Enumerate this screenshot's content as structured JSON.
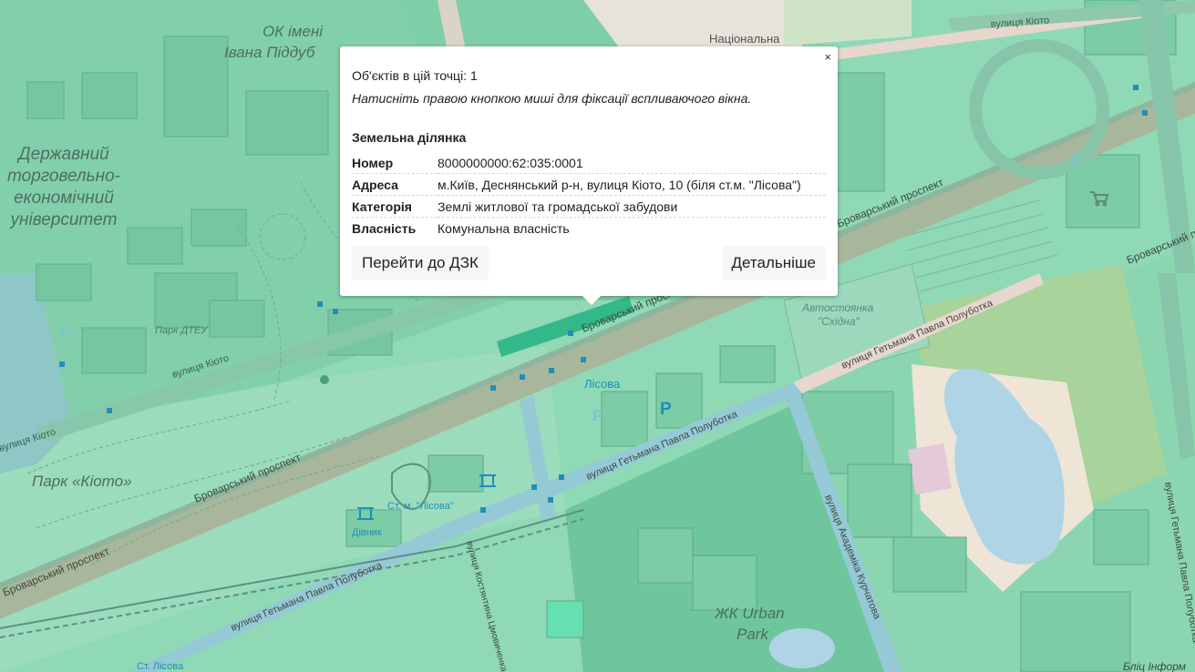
{
  "map": {
    "labels": {
      "ok_imeni": "ОК імені",
      "ivana": "Івана Піддуб",
      "natsionalna": "Національна",
      "univ1": "Державний",
      "univ2": "торговельно-",
      "univ3": "економічний",
      "univ4": "університет",
      "kioto_street_top": "вулиця Кіото",
      "kioto_street_mid": "вулиця Кіото",
      "kioto_street_left": "вулиця Кіото",
      "park_dteu": "Парк ДТЕУ",
      "brovarsky_1": "Броварський проспект",
      "brovarsky_2": "Броварський проспект",
      "brovarsky_3": "Броварський проспект",
      "brovarsky_4": "Броварський проспект",
      "brovarsky_5": "Броварський проспект",
      "park_kioto": "Парк «Кіото»",
      "lisova": "Лісова",
      "st_lisova": "Ст. м. \"Лісова\"",
      "divnyk": "Дівник",
      "polubotka_1": "вулиця Гетьмана Павла Полуботка",
      "polubotka_2": "вулиця Гетьмана Павла Полуботка",
      "polubotka_3": "вулиця Гетьмана Павла Полуботка",
      "polubotka_4": "вулиця Гетьмана Павла Полуботка",
      "autostoyanka1": "Автостоянка",
      "autostoyanka2": "\"Східна\"",
      "akad_kurchatova": "вулиця Академіка Курчатова",
      "katerynychivska": "вулиця Костянтина Цмовиченка",
      "urban1": "ЖК Urban",
      "urban2": "Park",
      "blyshch": "Бліц Інформ",
      "st_lisova_bottom": "Ст. Лісова",
      "parking_p": "P"
    },
    "colors": {
      "land": "#8fd9b6",
      "road": "#7fb9a3",
      "main_road": "#a9b99d",
      "water": "#aed4e6"
    }
  },
  "popup": {
    "close": "×",
    "count": "Об'єктів в цій точці: 1",
    "hint": "Натисніть правою кнопкою миші для фіксації вспливаючого вікна.",
    "title": "Земельна ділянка",
    "rows": [
      {
        "key": "Номер",
        "value": "8000000000:62:035:0001"
      },
      {
        "key": "Адреса",
        "value": "м.Київ, Деснянський р-н, вулиця Кіото, 10 (біля ст.м. \"Лісова\")"
      },
      {
        "key": "Категорія",
        "value": "Землі житлової та громадської забудови"
      },
      {
        "key": "Власність",
        "value": "Комунальна власність"
      }
    ],
    "btn_left": "Перейти до ДЗК",
    "btn_right": "Детальніше"
  }
}
